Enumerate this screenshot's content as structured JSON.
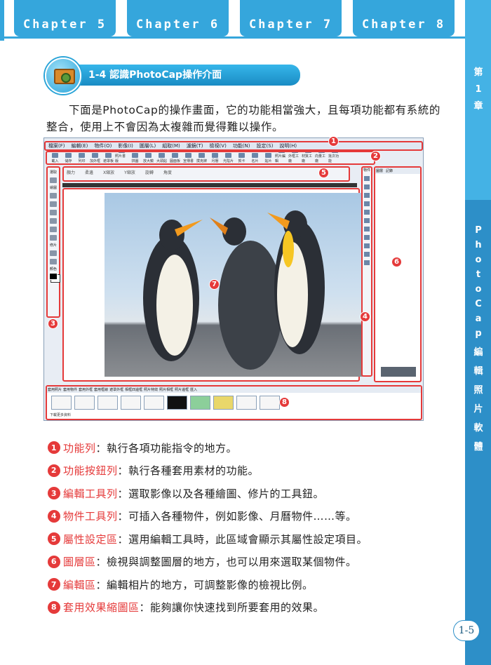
{
  "chapters": [
    "Chapter 5",
    "Chapter 6",
    "Chapter 7",
    "Chapter 8"
  ],
  "side": {
    "chapter": [
      "第",
      "1",
      "章"
    ],
    "title": [
      "P",
      "h",
      "o",
      "t",
      "o",
      "C",
      "a",
      "p",
      "編",
      "輯",
      "照",
      "片",
      "軟",
      "體"
    ]
  },
  "section": {
    "title": "1-4  認識PhotoCap操作介面"
  },
  "intro": "下面是PhotoCap的操作畫面，它的功能相當強大，且每項功能都有系統的整合，使用上不會因為太複雜而覺得難以操作。",
  "screenshot": {
    "menu": [
      "檔案(F)",
      "編輯(E)",
      "物件(O)",
      "影像(I)",
      "圖層(L)",
      "組取(M)",
      "濾鏡(T)",
      "檢視(V)",
      "功能(N)",
      "設定(S)",
      "說明(H)"
    ],
    "buttons": [
      "載入",
      "儲存",
      "列印",
      "加外框",
      "遮罩板",
      "照片書版",
      "拼圖",
      "放大鏡",
      "大頭貼",
      "圓面板",
      "宣傳書",
      "撲克牌",
      "月曆",
      "光陰片",
      "賀卡",
      "名片",
      "貼片",
      "照片編輯",
      "外框工廠",
      "材質工廠",
      "向量工廠",
      "批次功能"
    ],
    "tool_labels": [
      "選取",
      "繪圖",
      "修片",
      "顏色"
    ],
    "prop_labels": [
      "顏力",
      "柔邊",
      "X縮放",
      "Y縮放",
      "旋轉",
      "角度"
    ],
    "layer_tabs": [
      "圖層",
      "記錄"
    ],
    "object_label": "物件",
    "thumb_tabs": [
      "套用照片",
      "套用物件",
      "套用外框",
      "套用框線",
      "遮罩外框",
      "相框四邊框",
      "照片特效",
      "照片相框",
      "照片邊框",
      "匯入"
    ],
    "thumb_footer": "下載更多資料",
    "badges": [
      "1",
      "2",
      "3",
      "4",
      "5",
      "6",
      "7",
      "8"
    ]
  },
  "items": [
    {
      "n": "1",
      "term": "功能列",
      "desc": "：執行各項功能指令的地方。"
    },
    {
      "n": "2",
      "term": "功能按鈕列",
      "desc": "：執行各種套用素材的功能。"
    },
    {
      "n": "3",
      "term": "編輯工具列",
      "desc": "：選取影像以及各種繪圖、修片的工具鈕。"
    },
    {
      "n": "4",
      "term": "物件工具列",
      "desc": "：可插入各種物件，例如影像、月曆物件……等。"
    },
    {
      "n": "5",
      "term": "屬性設定區",
      "desc": "：選用編輯工具時，此區域會顯示其屬性設定項目。"
    },
    {
      "n": "6",
      "term": "圖層區",
      "desc": "：檢視與調整圖層的地方，也可以用來選取某個物件。"
    },
    {
      "n": "7",
      "term": "編輯區",
      "desc": "：編輯相片的地方，可調整影像的檢視比例。"
    },
    {
      "n": "8",
      "term": "套用效果縮圖區",
      "desc": "：能夠讓你快速找到所要套用的效果。"
    }
  ],
  "page_number": "1-5",
  "colors": {
    "accent": "#35a6dc",
    "side": "#2d8fc8",
    "marker": "#e53a3a"
  }
}
